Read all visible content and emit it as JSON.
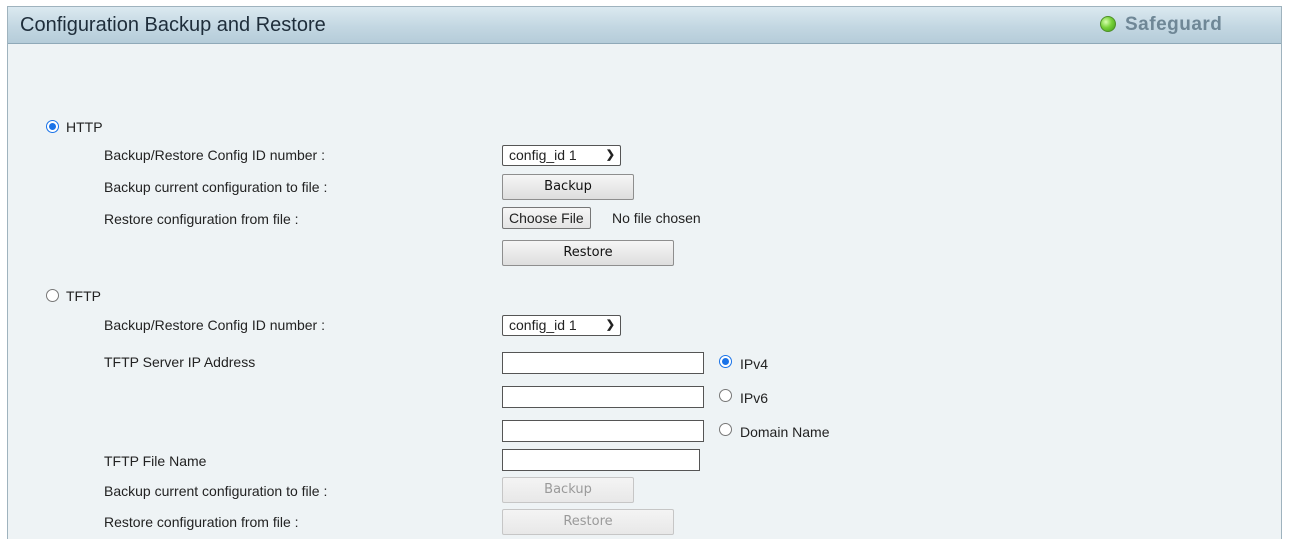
{
  "panel": {
    "title": "Configuration Backup and Restore",
    "status": {
      "label": "Safeguard",
      "color": "#5cc72a"
    }
  },
  "http": {
    "option_label": "HTTP",
    "selected": true,
    "config_id_label": "Backup/Restore Config ID number :",
    "config_id_value": "config_id 1",
    "backup_label": "Backup current configuration to file :",
    "backup_button": "Backup",
    "restore_label": "Restore configuration from file :",
    "choose_file_button": "Choose File",
    "file_status": "No file chosen",
    "restore_button": "Restore"
  },
  "tftp": {
    "option_label": "TFTP",
    "selected": false,
    "config_id_label": "Backup/Restore Config ID number :",
    "config_id_value": "config_id 1",
    "server_ip_label": "TFTP Server IP Address",
    "ipv4_value": "",
    "ipv4_label": "IPv4",
    "ipv6_value": "",
    "ipv6_label": "IPv6",
    "domain_value": "",
    "domain_label": "Domain Name",
    "address_type_selected": "IPv4",
    "file_name_label": "TFTP File Name",
    "file_name_value": "",
    "backup_label": "Backup current configuration to file :",
    "backup_button": "Backup",
    "restore_label": "Restore configuration from file :",
    "restore_button": "Restore"
  }
}
